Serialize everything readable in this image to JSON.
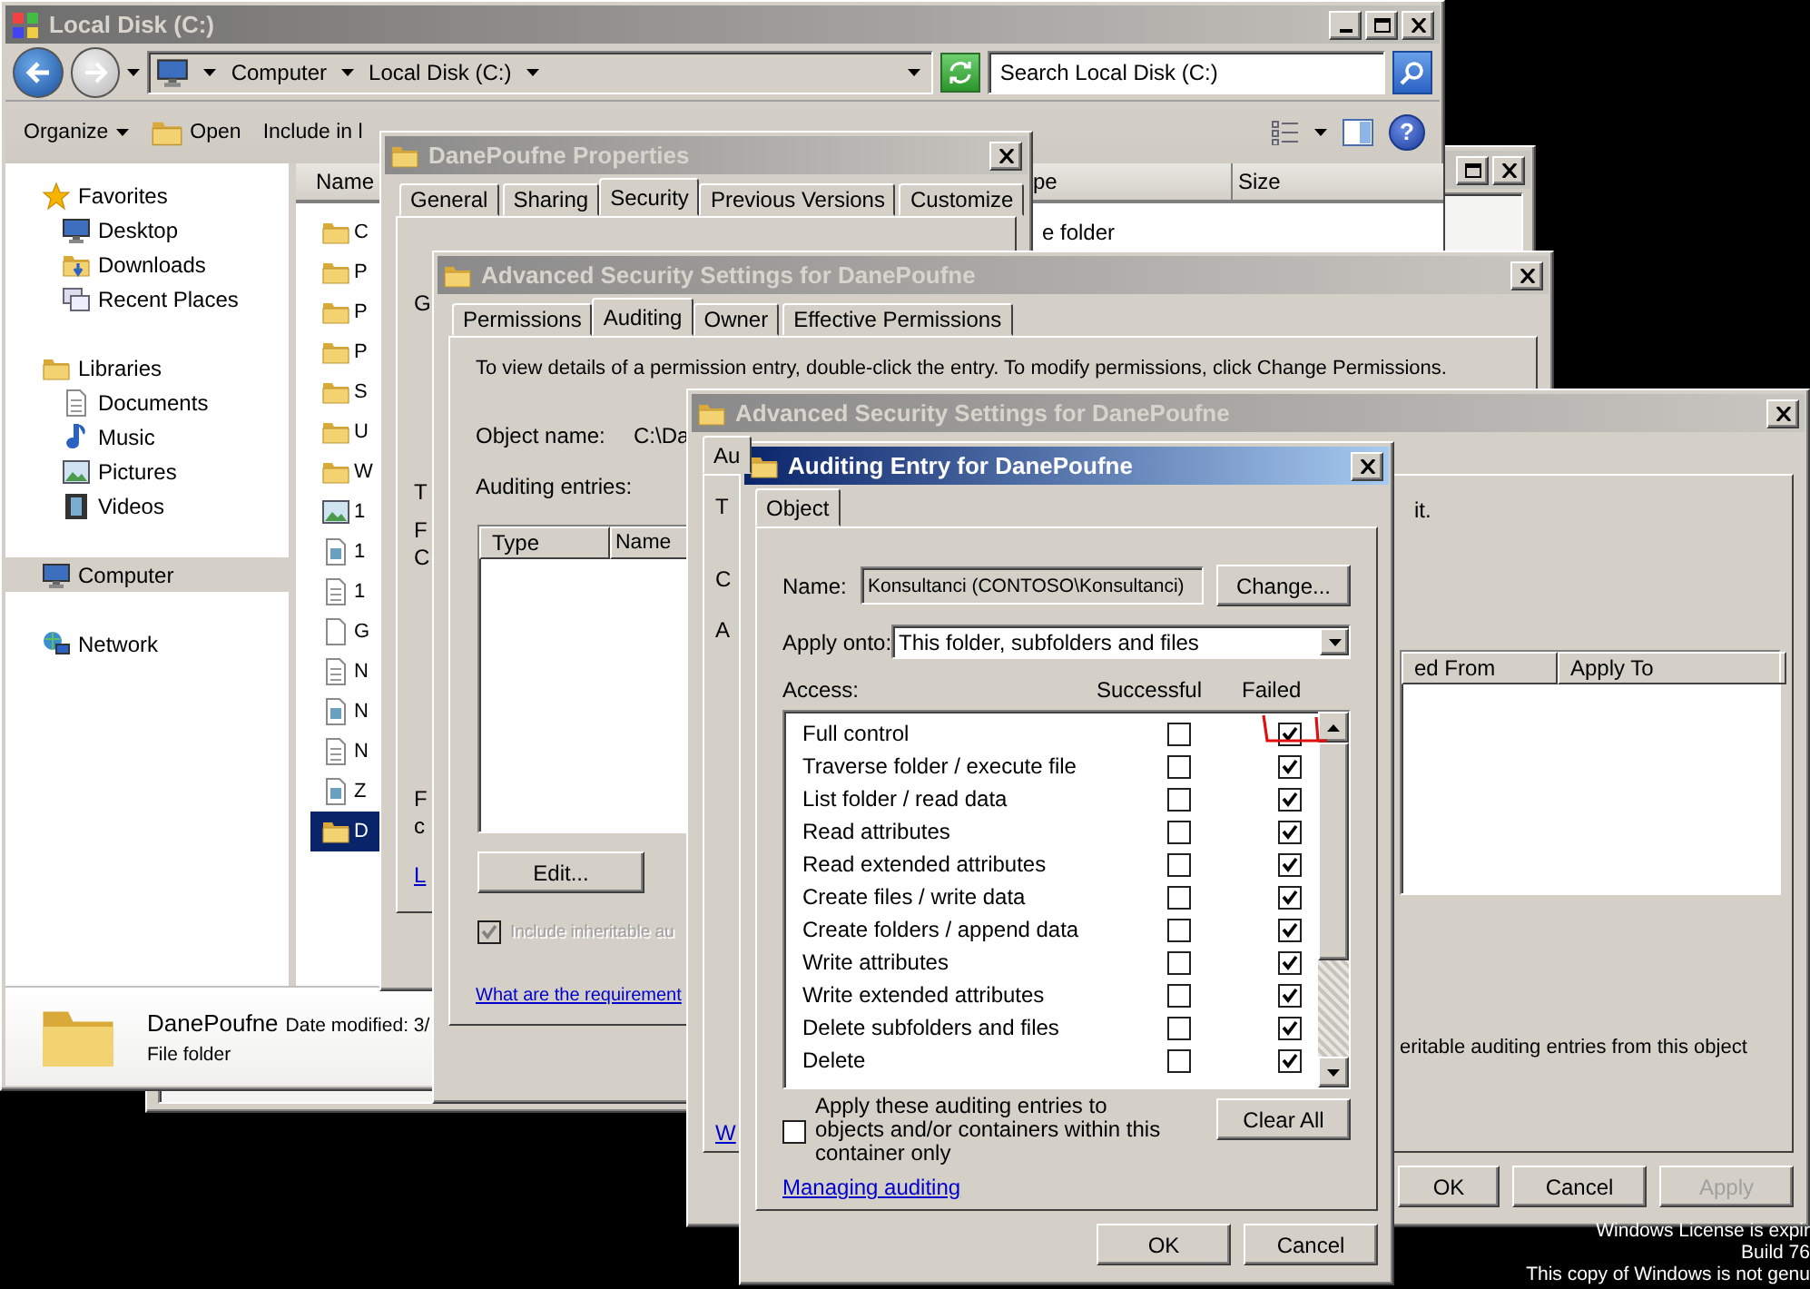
{
  "desktop": {
    "notice": [
      "Windows License is expir",
      "Build 76",
      "This copy of Windows is not genu"
    ]
  },
  "explorer": {
    "title": "Local Disk (C:)",
    "breadcrumb": [
      "Computer",
      "Local Disk (C:)"
    ],
    "search": {
      "placeholder": "Search Local Disk (C:)"
    },
    "help": "?",
    "toolbar": [
      {
        "label": "Organize",
        "kind": "menu"
      },
      {
        "label": "Open",
        "kind": "open"
      },
      {
        "label": "Include in l",
        "kind": "plain"
      }
    ],
    "nav": [
      {
        "label": "Favorites",
        "selected": false,
        "children": [
          {
            "label": "Desktop",
            "selected": false
          },
          {
            "label": "Downloads",
            "selected": false
          },
          {
            "label": "Recent Places",
            "selected": false
          }
        ]
      },
      {
        "label": "Libraries",
        "selected": false,
        "children": [
          {
            "label": "Documents",
            "selected": false
          },
          {
            "label": "Music",
            "selected": false
          },
          {
            "label": "Pictures",
            "selected": false
          },
          {
            "label": "Videos",
            "selected": false
          }
        ]
      },
      {
        "label": "Computer",
        "selected": true
      },
      {
        "label": "Network",
        "selected": false
      }
    ],
    "columns": [
      "Name",
      "pe",
      "Size"
    ],
    "files": [
      {
        "name": "C",
        "type": "e folder",
        "selected": false
      },
      {
        "name": "P",
        "selected": false
      },
      {
        "name": "P",
        "selected": false
      },
      {
        "name": "P",
        "selected": false
      },
      {
        "name": "S",
        "selected": false
      },
      {
        "name": "U",
        "selected": false
      },
      {
        "name": "W",
        "selected": false
      },
      {
        "name": "1",
        "selected": false
      },
      {
        "name": "1",
        "selected": false
      },
      {
        "name": "1",
        "selected": false
      },
      {
        "name": "G",
        "selected": false
      },
      {
        "name": "N",
        "selected": false
      },
      {
        "name": "N",
        "selected": false
      },
      {
        "name": "N",
        "selected": false
      },
      {
        "name": "Z",
        "selected": false
      },
      {
        "name": "D",
        "selected": true
      }
    ],
    "details": {
      "name": "DanePoufne",
      "modified": "Date modified: 3/",
      "type": "File folder"
    }
  },
  "properties": {
    "title": "DanePoufne Properties",
    "tabs": [
      {
        "label": "General",
        "selected": false
      },
      {
        "label": "Sharing",
        "selected": false
      },
      {
        "label": "Security",
        "selected": true
      },
      {
        "label": "Previous Versions",
        "selected": false
      },
      {
        "label": "Customize",
        "selected": false
      }
    ],
    "fragments": [
      {
        "text": "G",
        "kind": "text"
      },
      {
        "text": "T",
        "kind": "text"
      },
      {
        "text": "F",
        "kind": "text"
      },
      {
        "text": "C",
        "kind": "text"
      },
      {
        "text": "F",
        "kind": "text"
      },
      {
        "text": "c",
        "kind": "text"
      },
      {
        "text": "L",
        "kind": "link"
      }
    ]
  },
  "advanced": {
    "title": "Advanced Security Settings for DanePoufne",
    "tabs": [
      {
        "label": "Permissions",
        "selected": false
      },
      {
        "label": "Auditing",
        "selected": true
      },
      {
        "label": "Owner",
        "selected": false
      },
      {
        "label": "Effective Permissions",
        "selected": false
      }
    ],
    "intro": "To view details of a permission entry, double-click the entry. To modify permissions, click Change Permissions.",
    "object_name": {
      "label": "Object name:",
      "value": "C:\\Da"
    },
    "entries_label": "Auditing entries:",
    "columns": [
      "Type",
      "Name"
    ],
    "edit": "Edit...",
    "inherit": {
      "label": "Include inheritable au",
      "checked": true,
      "disabled": true
    },
    "link": "What are the requirement"
  },
  "advanced_2": {
    "title": "Advanced Security Settings for DanePoufne",
    "tabs": [
      {
        "label": "Au",
        "selected": true
      }
    ],
    "left_fragments": [
      {
        "text": "T",
        "kind": "text"
      },
      {
        "text": "C",
        "kind": "text"
      },
      {
        "text": "A",
        "kind": "text"
      },
      {
        "text": "W",
        "kind": "link"
      }
    ],
    "intro_end": "it.",
    "columns": [
      "ed From",
      "Apply To"
    ],
    "inherit_text": "eritable auditing entries from this object",
    "buttons": [
      {
        "label": "OK",
        "disabled": false
      },
      {
        "label": "Cancel",
        "disabled": false
      },
      {
        "label": "Apply",
        "disabled": true
      }
    ]
  },
  "auditing_entry": {
    "title": "Auditing Entry for DanePoufne",
    "tabs": [
      {
        "label": "Object",
        "selected": true
      }
    ],
    "name": {
      "label": "Name:",
      "value": "Konsultanci (CONTOSO\\Konsultanci)"
    },
    "change": "Change...",
    "apply_onto": {
      "label": "Apply onto:",
      "value": "This folder, subfolders and files"
    },
    "access_label": "Access:",
    "columns": [
      "Successful",
      "Failed"
    ],
    "rows": [
      {
        "label": "Full control",
        "successful": false,
        "failed": true
      },
      {
        "label": "Traverse folder / execute file",
        "successful": false,
        "failed": true
      },
      {
        "label": "List folder / read data",
        "successful": false,
        "failed": true
      },
      {
        "label": "Read attributes",
        "successful": false,
        "failed": true
      },
      {
        "label": "Read extended attributes",
        "successful": false,
        "failed": true
      },
      {
        "label": "Create files / write data",
        "successful": false,
        "failed": true
      },
      {
        "label": "Create folders / append data",
        "successful": false,
        "failed": true
      },
      {
        "label": "Write attributes",
        "successful": false,
        "failed": true
      },
      {
        "label": "Write extended attributes",
        "successful": false,
        "failed": true
      },
      {
        "label": "Delete subfolders and files",
        "successful": false,
        "failed": true
      },
      {
        "label": "Delete",
        "successful": false,
        "failed": true
      }
    ],
    "apply_only": {
      "label": "Apply these auditing entries to objects and/or containers within this container only",
      "checked": false
    },
    "clear_all": "Clear All",
    "link": "Managing auditing",
    "buttons": [
      "OK",
      "Cancel"
    ]
  }
}
